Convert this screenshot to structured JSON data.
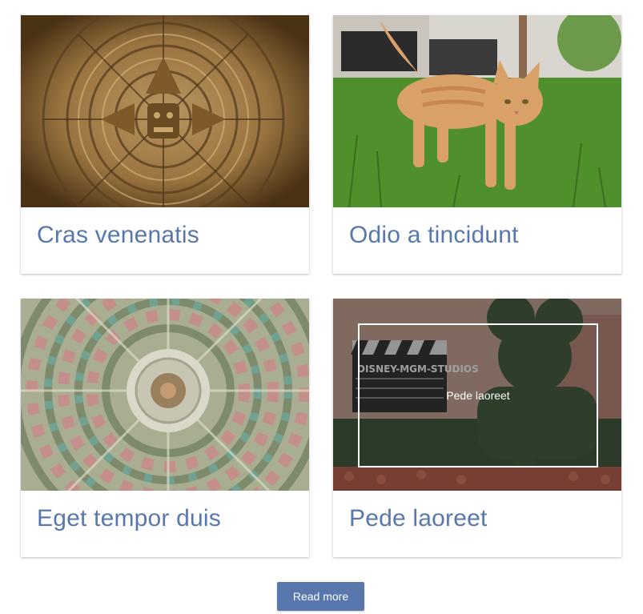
{
  "cards": [
    {
      "title": "Cras venenatis",
      "image": "aztec-calendar-stone"
    },
    {
      "title": "Odio a tincidunt",
      "image": "orange-cat-on-grass"
    },
    {
      "title": "Eget tempor duis",
      "image": "ornate-dome-ceiling"
    },
    {
      "title": "Pede laoreet",
      "image": "mickey-topiary-clapperboard",
      "overlay_caption": "Pede laoreet"
    }
  ],
  "read_more_label": "Read more",
  "colors": {
    "accent": "#5878ad",
    "card_bg": "#ffffff"
  }
}
